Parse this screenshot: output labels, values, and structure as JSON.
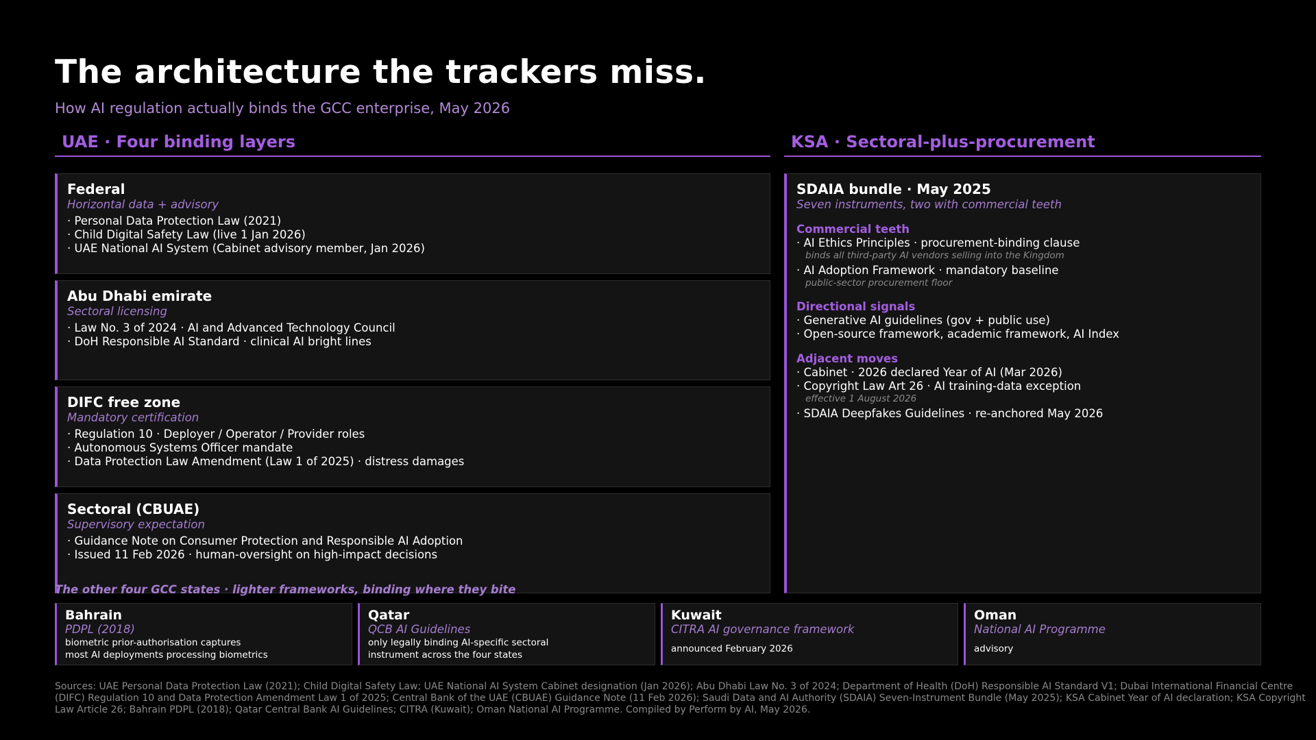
{
  "title": "The architecture the trackers miss.",
  "subtitle": "How AI regulation actually binds the GCC enterprise, May 2026",
  "colors": {
    "accent": "#9a55d6",
    "heading_purple": "#a35ee0",
    "muted_purple": "#a57cd0",
    "card_bg": "#141414",
    "background": "#000000"
  },
  "uae": {
    "heading": "UAE  ·  Four binding layers",
    "cards": [
      {
        "title": "Federal",
        "sub": "Horizontal data + advisory",
        "bullets": [
          "Personal Data Protection Law (2021)",
          "Child Digital Safety Law (live 1 Jan 2026)",
          "UAE National AI System (Cabinet advisory member, Jan 2026)"
        ]
      },
      {
        "title": "Abu Dhabi emirate",
        "sub": "Sectoral licensing",
        "bullets": [
          "Law No. 3 of 2024  ·  AI and Advanced Technology Council",
          "DoH Responsible AI Standard  ·  clinical AI bright lines"
        ]
      },
      {
        "title": "DIFC free zone",
        "sub": "Mandatory certification",
        "bullets": [
          "Regulation 10  ·  Deployer / Operator / Provider roles",
          "Autonomous Systems Officer mandate",
          "Data Protection Law Amendment (Law 1 of 2025)  ·  distress damages"
        ]
      },
      {
        "title": "Sectoral (CBUAE)",
        "sub": "Supervisory expectation",
        "bullets": [
          "Guidance Note on Consumer Protection and Responsible AI Adoption",
          "Issued 11 Feb 2026  ·  human-oversight on high-impact decisions"
        ]
      }
    ]
  },
  "ksa": {
    "heading": "KSA  ·  Sectoral-plus-procurement",
    "card_title": "SDAIA bundle  ·  May 2025",
    "card_sub": "Seven instruments, two with commercial teeth",
    "groups": {
      "commercial": {
        "head": "Commercial teeth",
        "b1": "AI Ethics Principles  ·  procurement-binding clause",
        "n1": "binds all third-party AI vendors selling into the Kingdom",
        "b2": "AI Adoption Framework  ·  mandatory baseline",
        "n2": "public-sector procurement floor"
      },
      "directional": {
        "head": "Directional signals",
        "b1": "Generative AI guidelines (gov + public use)",
        "b2": "Open-source framework, academic framework, AI Index"
      },
      "adjacent": {
        "head": "Adjacent moves",
        "b1": "Cabinet  ·  2026 declared Year of AI (Mar 2026)",
        "b2": "Copyright Law Art 26  ·  AI training-data exception",
        "n2": "effective 1 August 2026",
        "b3": "SDAIA Deepfakes Guidelines  ·  re-anchored May 2026"
      }
    }
  },
  "other": {
    "caption": "The other four GCC states  ·  lighter frameworks, binding where they bite",
    "states": [
      {
        "name": "Bahrain",
        "framework": "PDPL (2018)",
        "line1": "biometric prior-authorisation captures",
        "line2": "most AI deployments processing biometrics"
      },
      {
        "name": "Qatar",
        "framework": "QCB AI Guidelines",
        "line1": "only legally binding AI-specific sectoral",
        "line2": "instrument across the four states"
      },
      {
        "name": "Kuwait",
        "framework": "CITRA AI governance framework",
        "line1": "announced February 2026",
        "line2": ""
      },
      {
        "name": "Oman",
        "framework": "National AI Programme",
        "line1": "advisory",
        "line2": ""
      }
    ]
  },
  "sources": "Sources: UAE Personal Data Protection Law (2021); Child Digital Safety Law; UAE National AI System Cabinet designation (Jan 2026); Abu Dhabi Law No. 3 of 2024; Department of Health (DoH) Responsible AI Standard V1; Dubai International Financial Centre (DIFC) Regulation 10 and Data Protection Amendment Law 1 of 2025; Central Bank of the UAE (CBUAE) Guidance Note (11 Feb 2026); Saudi Data and AI Authority (SDAIA) Seven-Instrument Bundle (May 2025); KSA Cabinet Year of AI declaration; KSA Copyright Law Article 26; Bahrain PDPL (2018); Qatar Central Bank AI Guidelines; CITRA (Kuwait); Oman National AI Programme. Compiled by Perform by AI, May 2026."
}
